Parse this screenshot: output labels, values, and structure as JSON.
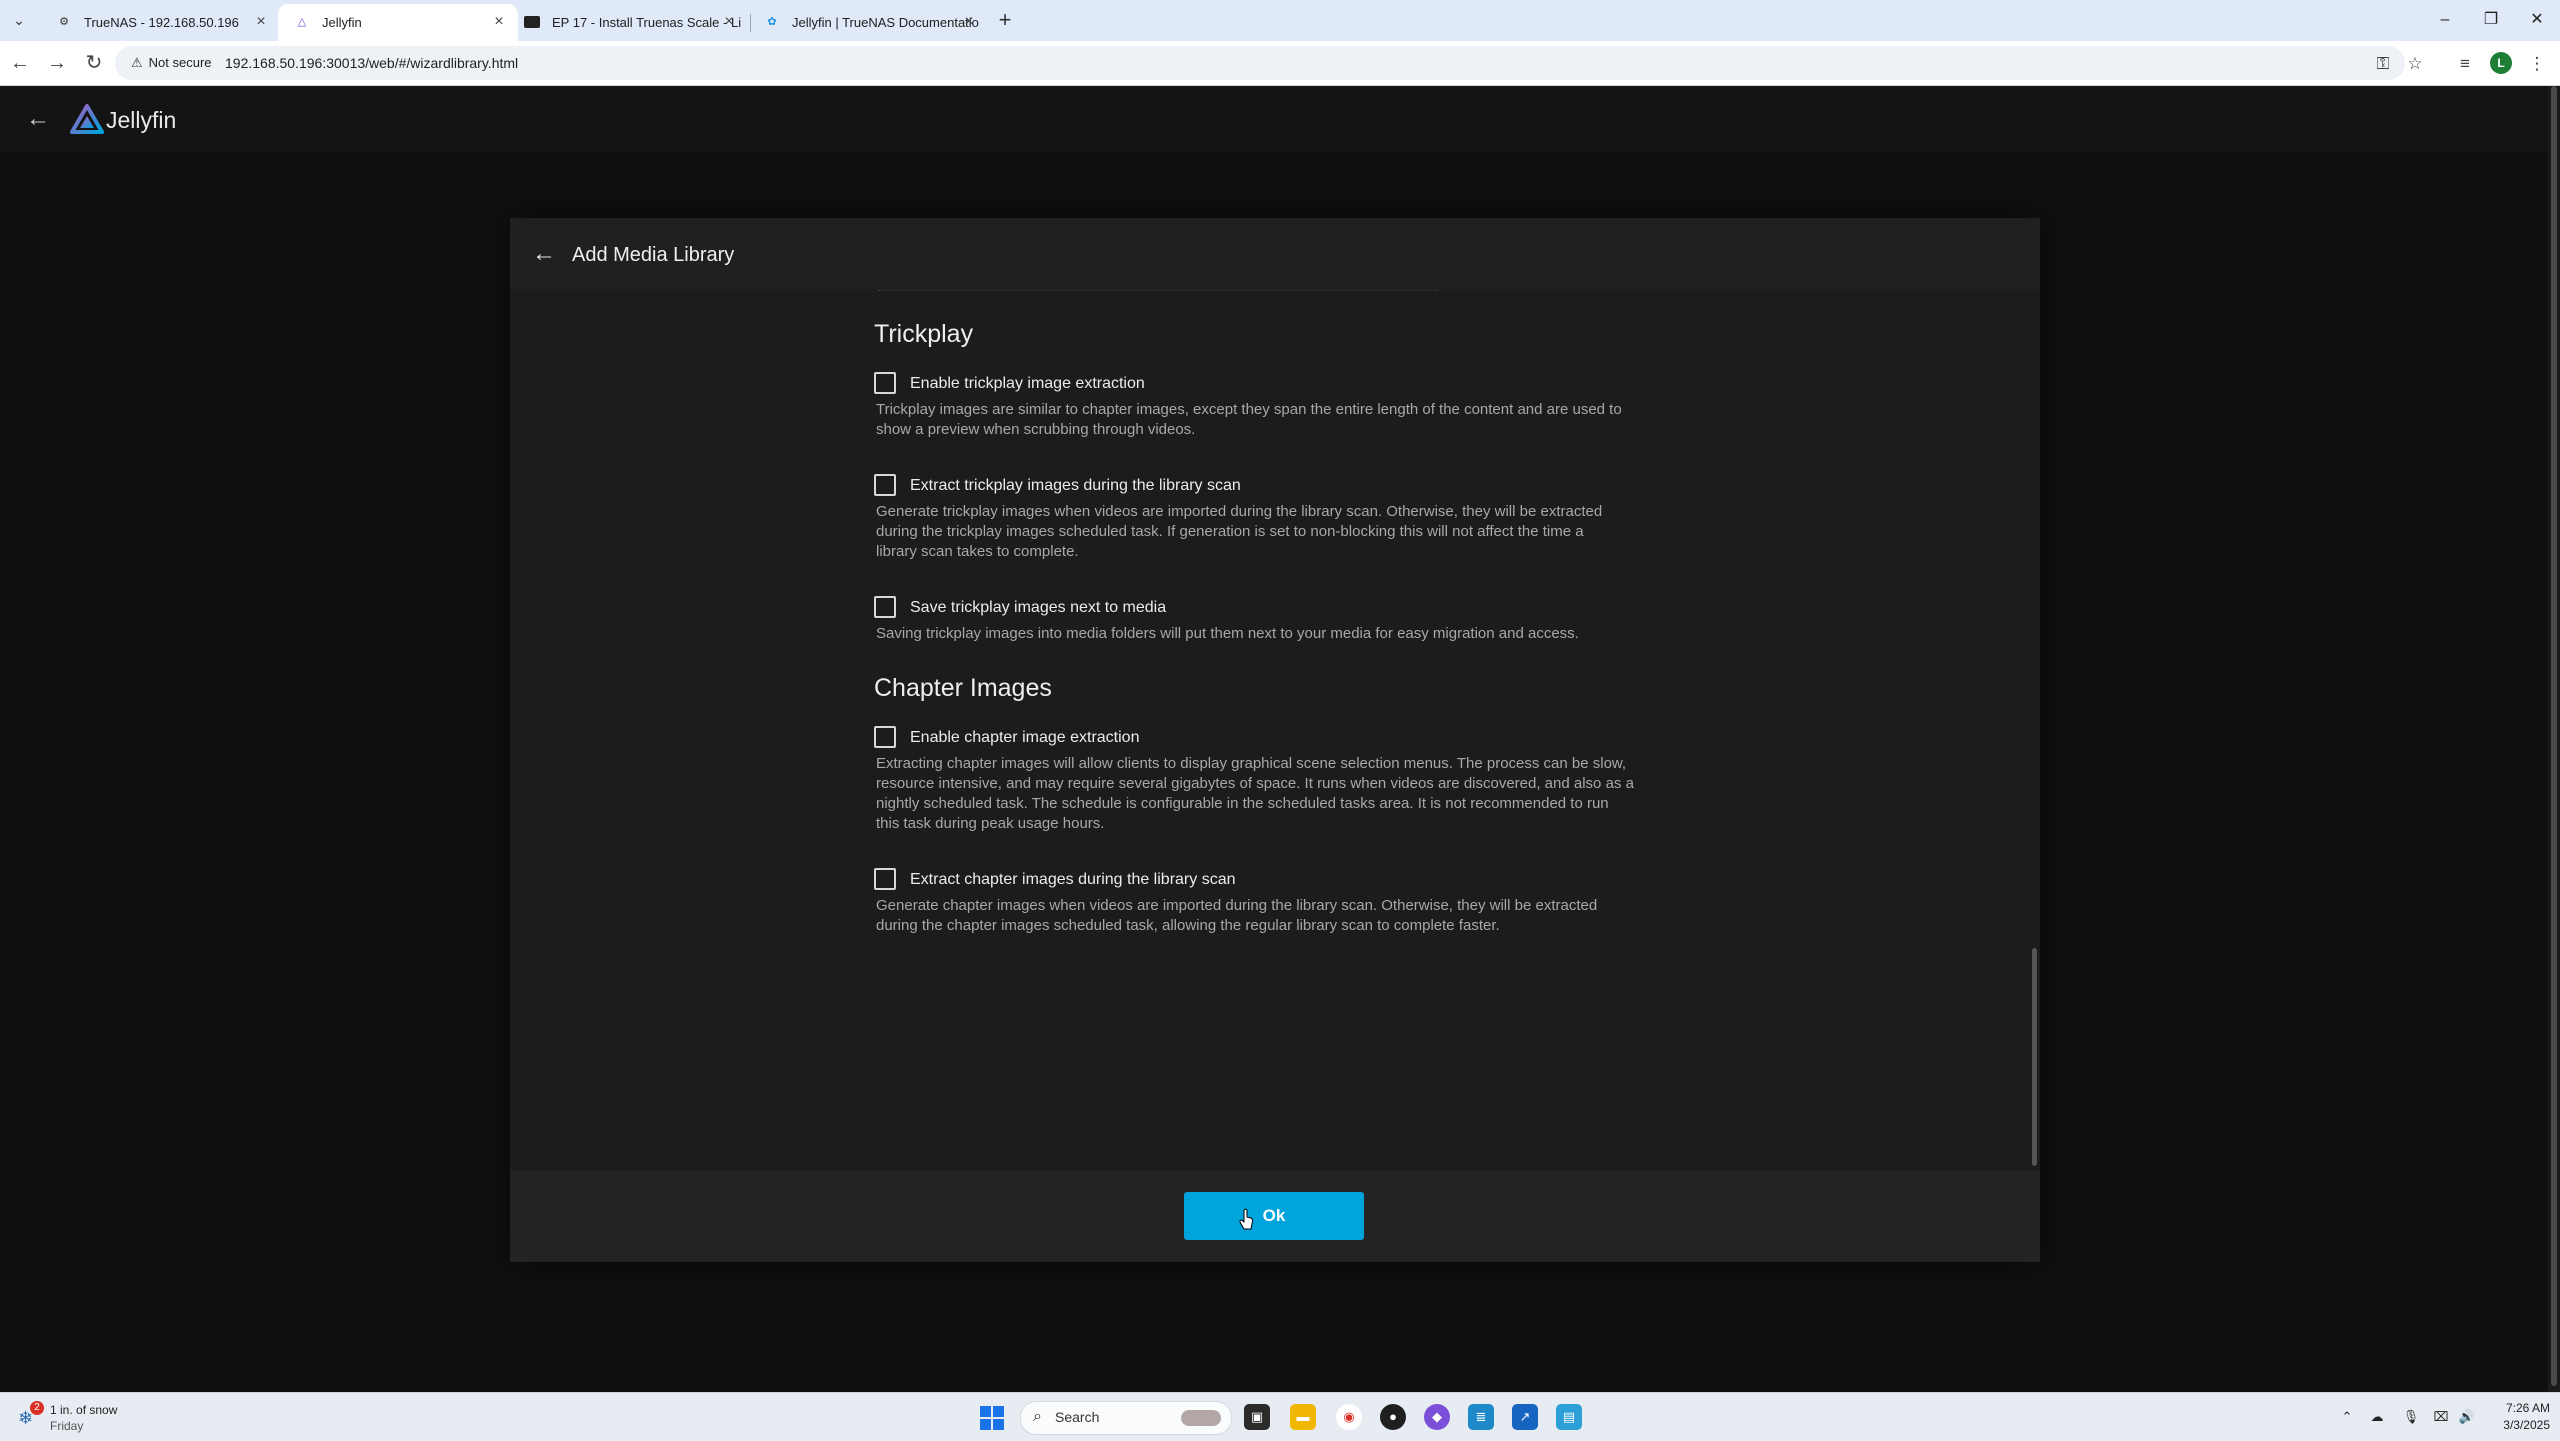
{
  "browser": {
    "tabs": [
      {
        "title": "TrueNAS - 192.168.50.196",
        "active": false,
        "icon": "truenas-icon"
      },
      {
        "title": "Jellyfin",
        "active": true,
        "icon": "jellyfin-icon"
      },
      {
        "title": "EP 17 - Install Truenas Scale - Li",
        "active": false,
        "icon": "video-icon"
      },
      {
        "title": "Jellyfin | TrueNAS Documentatio",
        "active": false,
        "icon": "truenas-docs-icon"
      }
    ],
    "security_label": "Not secure",
    "url": "192.168.50.196:30013/web/#/wizardlibrary.html",
    "profile_initial": "L"
  },
  "app": {
    "name": "Jellyfin",
    "accent_color": "#00a4dc"
  },
  "dialog": {
    "title": "Add Media Library",
    "sections": [
      {
        "title": "Trickplay",
        "options": [
          {
            "label": "Enable trickplay image extraction",
            "checked": false,
            "description": [
              "Trickplay images are similar to chapter images, except they span the entire length of the content and are used to",
              "show a preview when scrubbing through videos."
            ]
          },
          {
            "label": "Extract trickplay images during the library scan",
            "checked": false,
            "description": [
              "Generate trickplay images when videos are imported during the library scan. Otherwise, they will be extracted",
              "during the trickplay images scheduled task. If generation is set to non-blocking this will not affect the time a",
              "library scan takes to complete."
            ]
          },
          {
            "label": "Save trickplay images next to media",
            "checked": false,
            "description": [
              "Saving trickplay images into media folders will put them next to your media for easy migration and access."
            ]
          }
        ]
      },
      {
        "title": "Chapter Images",
        "options": [
          {
            "label": "Enable chapter image extraction",
            "checked": false,
            "description": [
              "Extracting chapter images will allow clients to display graphical scene selection menus. The process can be slow,",
              "resource intensive, and may require several gigabytes of space. It runs when videos are discovered, and also as a",
              "nightly scheduled task. The schedule is configurable in the scheduled tasks area. It is not recommended to run",
              "this task during peak usage hours."
            ]
          },
          {
            "label": "Extract chapter images during the library scan",
            "checked": false,
            "description": [
              "Generate chapter images when videos are imported during the library scan. Otherwise, they will be extracted",
              "during the chapter images scheduled task, allowing the regular library scan to complete faster."
            ]
          }
        ]
      }
    ],
    "ok_label": "Ok"
  },
  "taskbar": {
    "weather": {
      "line1": "1 in. of snow",
      "line2": "Friday",
      "badge": "2"
    },
    "search_label": "Search",
    "time": "7:26 AM",
    "date": "3/3/2025"
  }
}
